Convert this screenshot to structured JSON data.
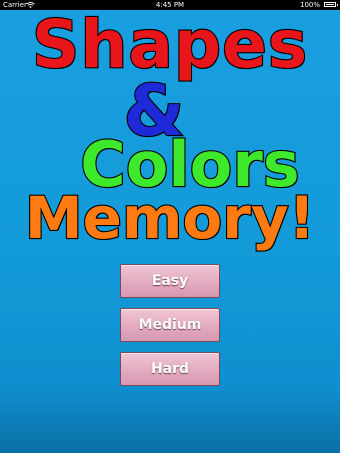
{
  "status_bar": {
    "carrier": "Carrier",
    "time": "4:45 PM",
    "battery": "100%",
    "icons": [
      "wifi-icon",
      "battery-icon"
    ]
  },
  "title": {
    "line1": "Shapes",
    "line2": "&",
    "line3": "Colors",
    "line4": "Memory!",
    "colors": {
      "line1": "#e8161b",
      "line2": "#1e2ad8",
      "line3": "#3ee82a",
      "line4": "#ff7b12"
    }
  },
  "menu": {
    "easy_label": "Easy",
    "medium_label": "Medium",
    "hard_label": "Hard"
  },
  "colors": {
    "background": "#139ad8",
    "button": "#e3aac0"
  }
}
